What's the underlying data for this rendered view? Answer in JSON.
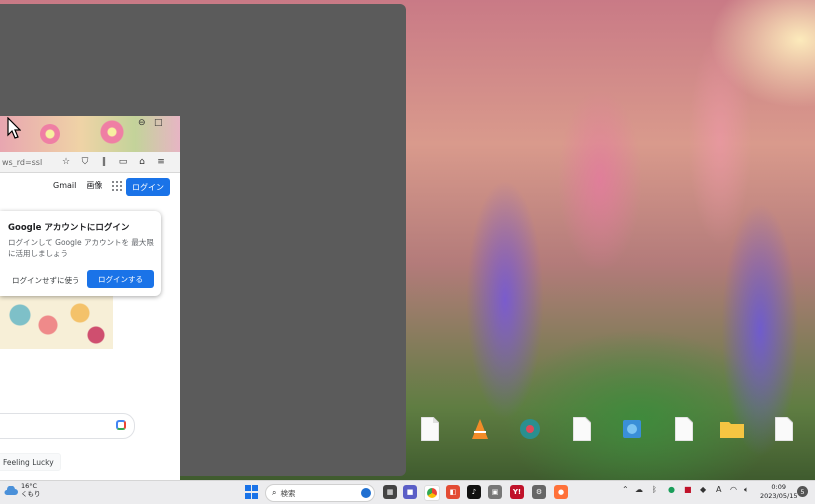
{
  "browser": {
    "url_fragment": "ws_rd=ssl",
    "top_links": {
      "gmail": "Gmail",
      "images": "画像"
    },
    "signin_button": "ログイン",
    "lucky_button": "Feeling Lucky",
    "popup": {
      "title": "Google アカウントにログイン",
      "body": "ログインして Google アカウントを 最大限に活用しましょう",
      "skip": "ログインせずに使う",
      "signin": "ログインする"
    }
  },
  "taskbar": {
    "weather_temp": "16°C",
    "weather_desc": "くもり",
    "search_label": "検索",
    "clock_time": "0:09",
    "clock_date": "2023/05/15",
    "ime_label": "A",
    "notification_count": "5"
  },
  "colors": {
    "accent": "#1a73e8",
    "panel": "#5b5b5b",
    "taskbar": "#ececee"
  }
}
